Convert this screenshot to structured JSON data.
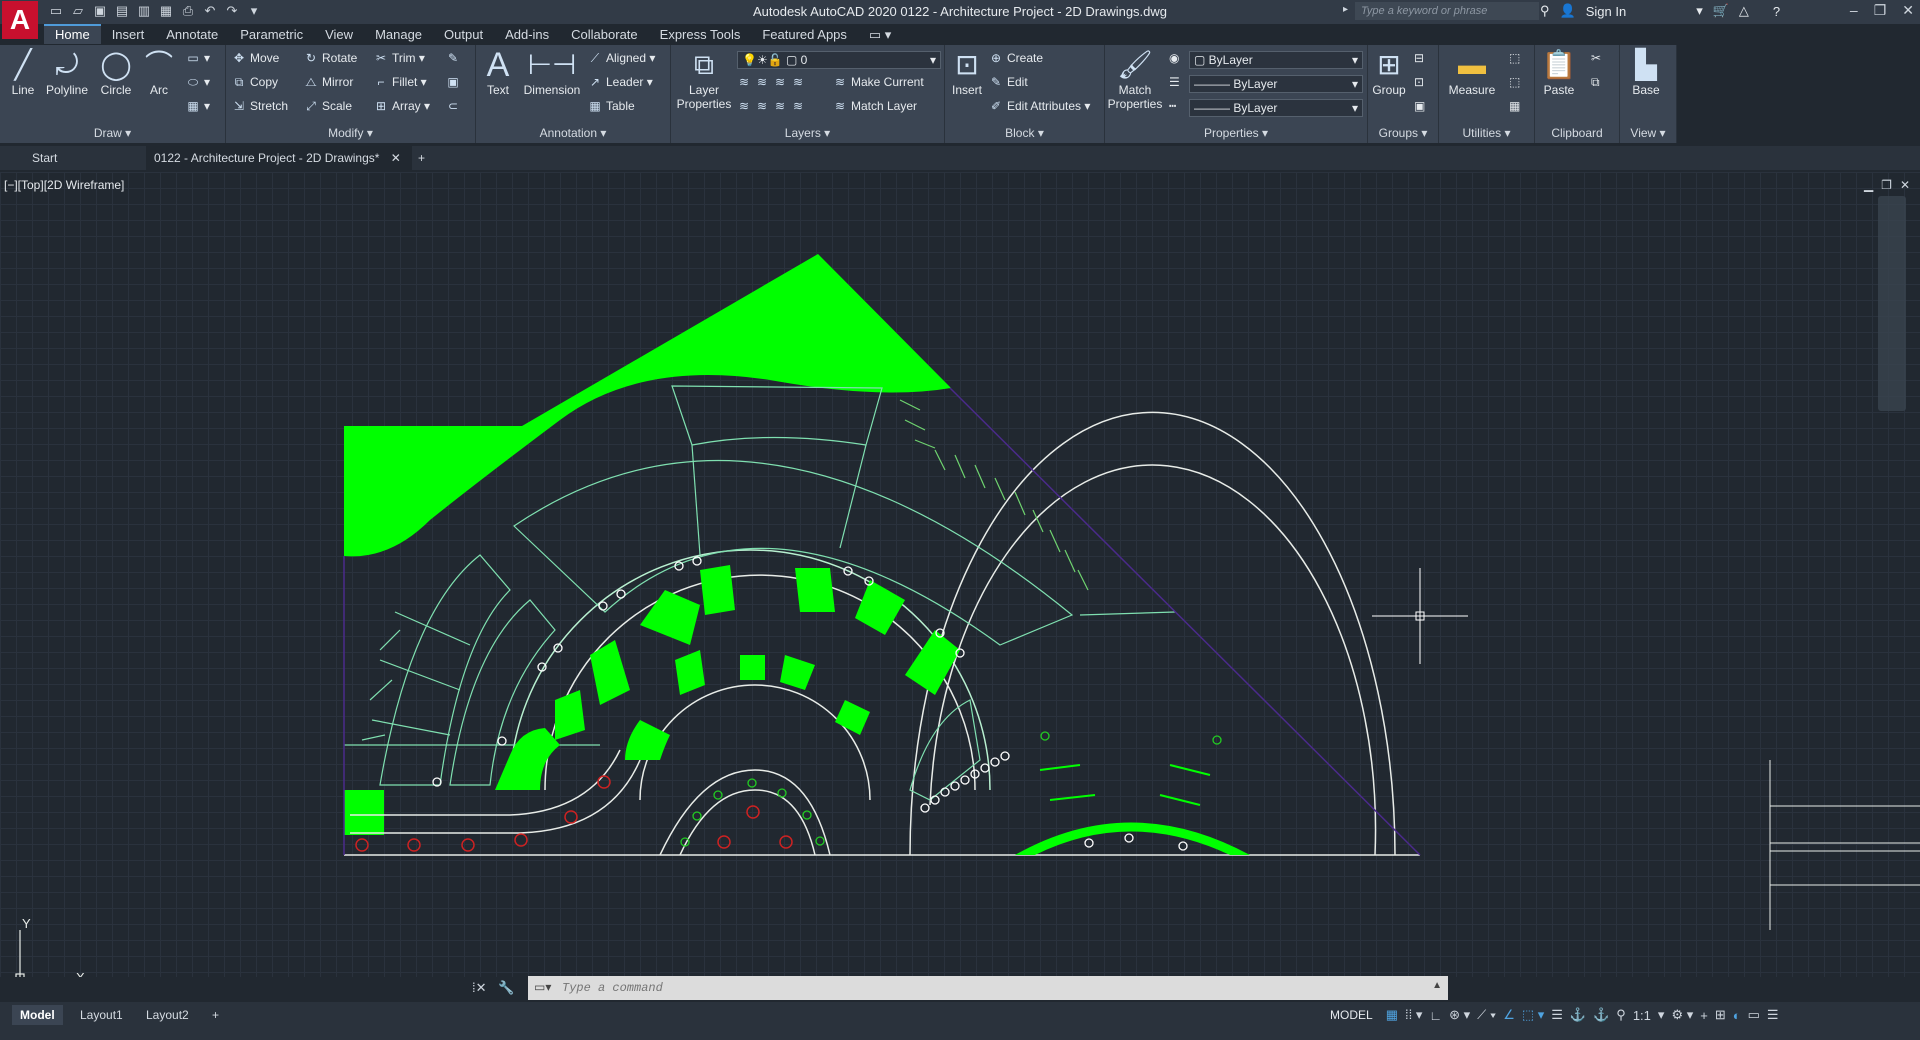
{
  "titlebar": {
    "title": "Autodesk AutoCAD 2020    0122 - Architecture Project - 2D Drawings.dwg",
    "search_placeholder": "Type a keyword or phrase",
    "sign_in": "Sign In"
  },
  "ribbon_tabs": [
    "Home",
    "Insert",
    "Annotate",
    "Parametric",
    "View",
    "Manage",
    "Output",
    "Add-ins",
    "Collaborate",
    "Express Tools",
    "Featured Apps"
  ],
  "panels": {
    "draw": {
      "label": "Draw",
      "line": "Line",
      "polyline": "Polyline",
      "circle": "Circle",
      "arc": "Arc"
    },
    "modify": {
      "label": "Modify",
      "move": "Move",
      "rotate": "Rotate",
      "trim": "Trim",
      "copy": "Copy",
      "mirror": "Mirror",
      "fillet": "Fillet",
      "stretch": "Stretch",
      "scale": "Scale",
      "array": "Array"
    },
    "annotation": {
      "label": "Annotation",
      "text": "Text",
      "dimension": "Dimension",
      "aligned": "Aligned",
      "leader": "Leader",
      "table": "Table"
    },
    "layers": {
      "label": "Layers",
      "layer_properties": "Layer Properties",
      "current_layer": "0",
      "make_current": "Make Current",
      "match_layer": "Match Layer"
    },
    "block": {
      "label": "Block",
      "insert": "Insert",
      "create": "Create",
      "edit": "Edit",
      "edit_attributes": "Edit Attributes"
    },
    "properties": {
      "label": "Properties",
      "match_properties": "Match Properties",
      "color": "ByLayer",
      "linetype": "ByLayer",
      "lineweight": "ByLayer"
    },
    "groups": {
      "label": "Groups",
      "group": "Group"
    },
    "utilities": {
      "label": "Utilities",
      "measure": "Measure"
    },
    "clipboard": {
      "label": "Clipboard",
      "paste": "Paste"
    },
    "view": {
      "label": "View",
      "base": "Base"
    }
  },
  "doc_tabs": {
    "start": "Start",
    "active": "0122 - Architecture Project - 2D Drawings*"
  },
  "viewport": {
    "label": "[−][Top][2D Wireframe]",
    "ucs_x": "X",
    "ucs_y": "Y"
  },
  "command": {
    "placeholder": "Type a command"
  },
  "layout_tabs": [
    "Model",
    "Layout1",
    "Layout2"
  ],
  "status": {
    "model": "MODEL",
    "scale": "1:1"
  },
  "colors": {
    "accent_green": "#00ff00",
    "background": "#212830",
    "ribbon": "#3b4553"
  }
}
